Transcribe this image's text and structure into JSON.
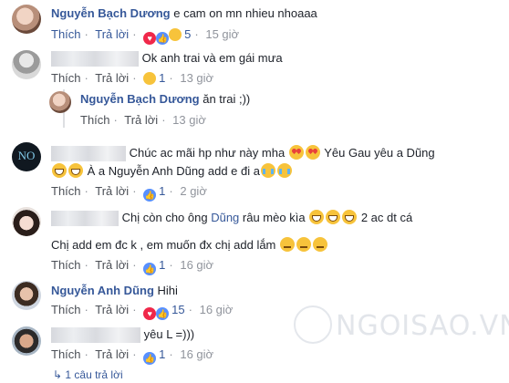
{
  "comments": [
    {
      "author": "Nguyễn Bạch Dương",
      "text": "e cam on mn nhieu nhoaaa",
      "like": "Thích",
      "reply": "Trả lời",
      "reactions_count": "5",
      "time": "15 giờ"
    },
    {
      "author": "",
      "text": "Ok anh trai và em gái mưa",
      "like": "Thích",
      "reply": "Trả lời",
      "reactions_count": "1",
      "time": "13 giờ"
    },
    {
      "author": "Nguyễn Bạch Dương",
      "text": "ăn trai ;))",
      "like": "Thích",
      "reply": "Trả lời",
      "time": "13 giờ"
    },
    {
      "author": "",
      "text_line1": "Chúc ac mãi hp như này mha",
      "text_line1b": "Yêu Gau yêu a Dũng",
      "text_line2": "À a Nguyễn Anh Dũng add e đi a",
      "like": "Thích",
      "reply": "Trả lời",
      "reactions_count": "1",
      "time": "2 giờ"
    },
    {
      "author": "",
      "text_line1a": "Chị còn cho ông",
      "text_line1_link": "Dũng",
      "text_line1b": "râu mèo kìa",
      "text_line1c": "2 ac dt cá",
      "text_line2": "Chị add em đc k , em muốn đx chị add lắm",
      "like": "Thích",
      "reply": "Trả lời",
      "reactions_count": "1",
      "time": "16 giờ"
    },
    {
      "author": "Nguyễn Anh Dũng",
      "text": "Hihi",
      "like": "Thích",
      "reply": "Trả lời",
      "reactions_count": "15",
      "time": "16 giờ"
    },
    {
      "author": "",
      "text": "yêu L =)))",
      "like": "Thích",
      "reply": "Trả lời",
      "reactions_count": "1",
      "time": "16 giờ"
    }
  ],
  "more_replies": "1 câu trả lời",
  "avatar_text": "NO",
  "watermark": "NGOISAO.VN",
  "colors": {
    "link": "#365899",
    "meta": "#90949c",
    "reaction_like": "#5890ff",
    "reaction_heart": "#f0284a"
  }
}
